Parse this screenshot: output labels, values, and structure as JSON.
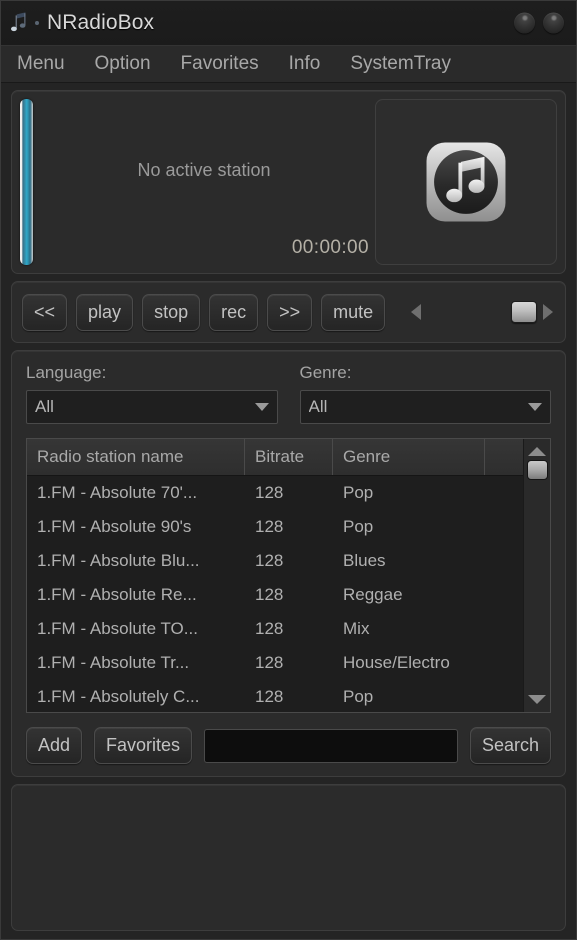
{
  "window": {
    "title": "NRadioBox",
    "logo_icon": "nradiobox-logo-icon",
    "minimize_label": "",
    "close_label": ""
  },
  "menu": {
    "items": [
      {
        "label": "Menu"
      },
      {
        "label": "Option"
      },
      {
        "label": "Favorites"
      },
      {
        "label": "Info"
      },
      {
        "label": "SystemTray"
      }
    ]
  },
  "display": {
    "station_text": "No active station",
    "timer": "00:00:00",
    "cover_icon": "music-note-icon",
    "level_meter_color": "#2ea8c9"
  },
  "transport": {
    "buttons": [
      {
        "label": "<<",
        "name": "previous-button"
      },
      {
        "label": "play",
        "name": "play-button"
      },
      {
        "label": "stop",
        "name": "stop-button"
      },
      {
        "label": "rec",
        "name": "record-button"
      },
      {
        "label": ">>",
        "name": "next-button"
      },
      {
        "label": "mute",
        "name": "mute-button"
      }
    ],
    "volume": {
      "left_arrow_icon": "volume-decrease-icon",
      "right_arrow_icon": "volume-increase-icon",
      "thumb_position_pct": 82
    }
  },
  "filters": {
    "language": {
      "label": "Language:",
      "value": "All"
    },
    "genre": {
      "label": "Genre:",
      "value": "All"
    }
  },
  "table": {
    "columns": [
      "Radio station name",
      "Bitrate",
      "Genre",
      ""
    ],
    "rows": [
      {
        "name": "1.FM - Absolute 70'...",
        "bitrate": "128",
        "genre": "Pop"
      },
      {
        "name": "1.FM - Absolute 90's",
        "bitrate": "128",
        "genre": "Pop"
      },
      {
        "name": "1.FM - Absolute Blu...",
        "bitrate": "128",
        "genre": "Blues"
      },
      {
        "name": "1.FM - Absolute Re...",
        "bitrate": "128",
        "genre": "Reggae"
      },
      {
        "name": "1.FM - Absolute TO...",
        "bitrate": "128",
        "genre": "Mix"
      },
      {
        "name": "1.FM - Absolute Tr...",
        "bitrate": "128",
        "genre": "House/Electro"
      },
      {
        "name": "1.FM - Absolutely C...",
        "bitrate": "128",
        "genre": "Pop"
      }
    ],
    "scrollbar": {
      "up_icon": "scroll-up-icon",
      "down_icon": "scroll-down-icon"
    }
  },
  "actions": {
    "add_label": "Add",
    "favorites_label": "Favorites",
    "search_label": "Search",
    "search_value": "",
    "search_placeholder": ""
  }
}
